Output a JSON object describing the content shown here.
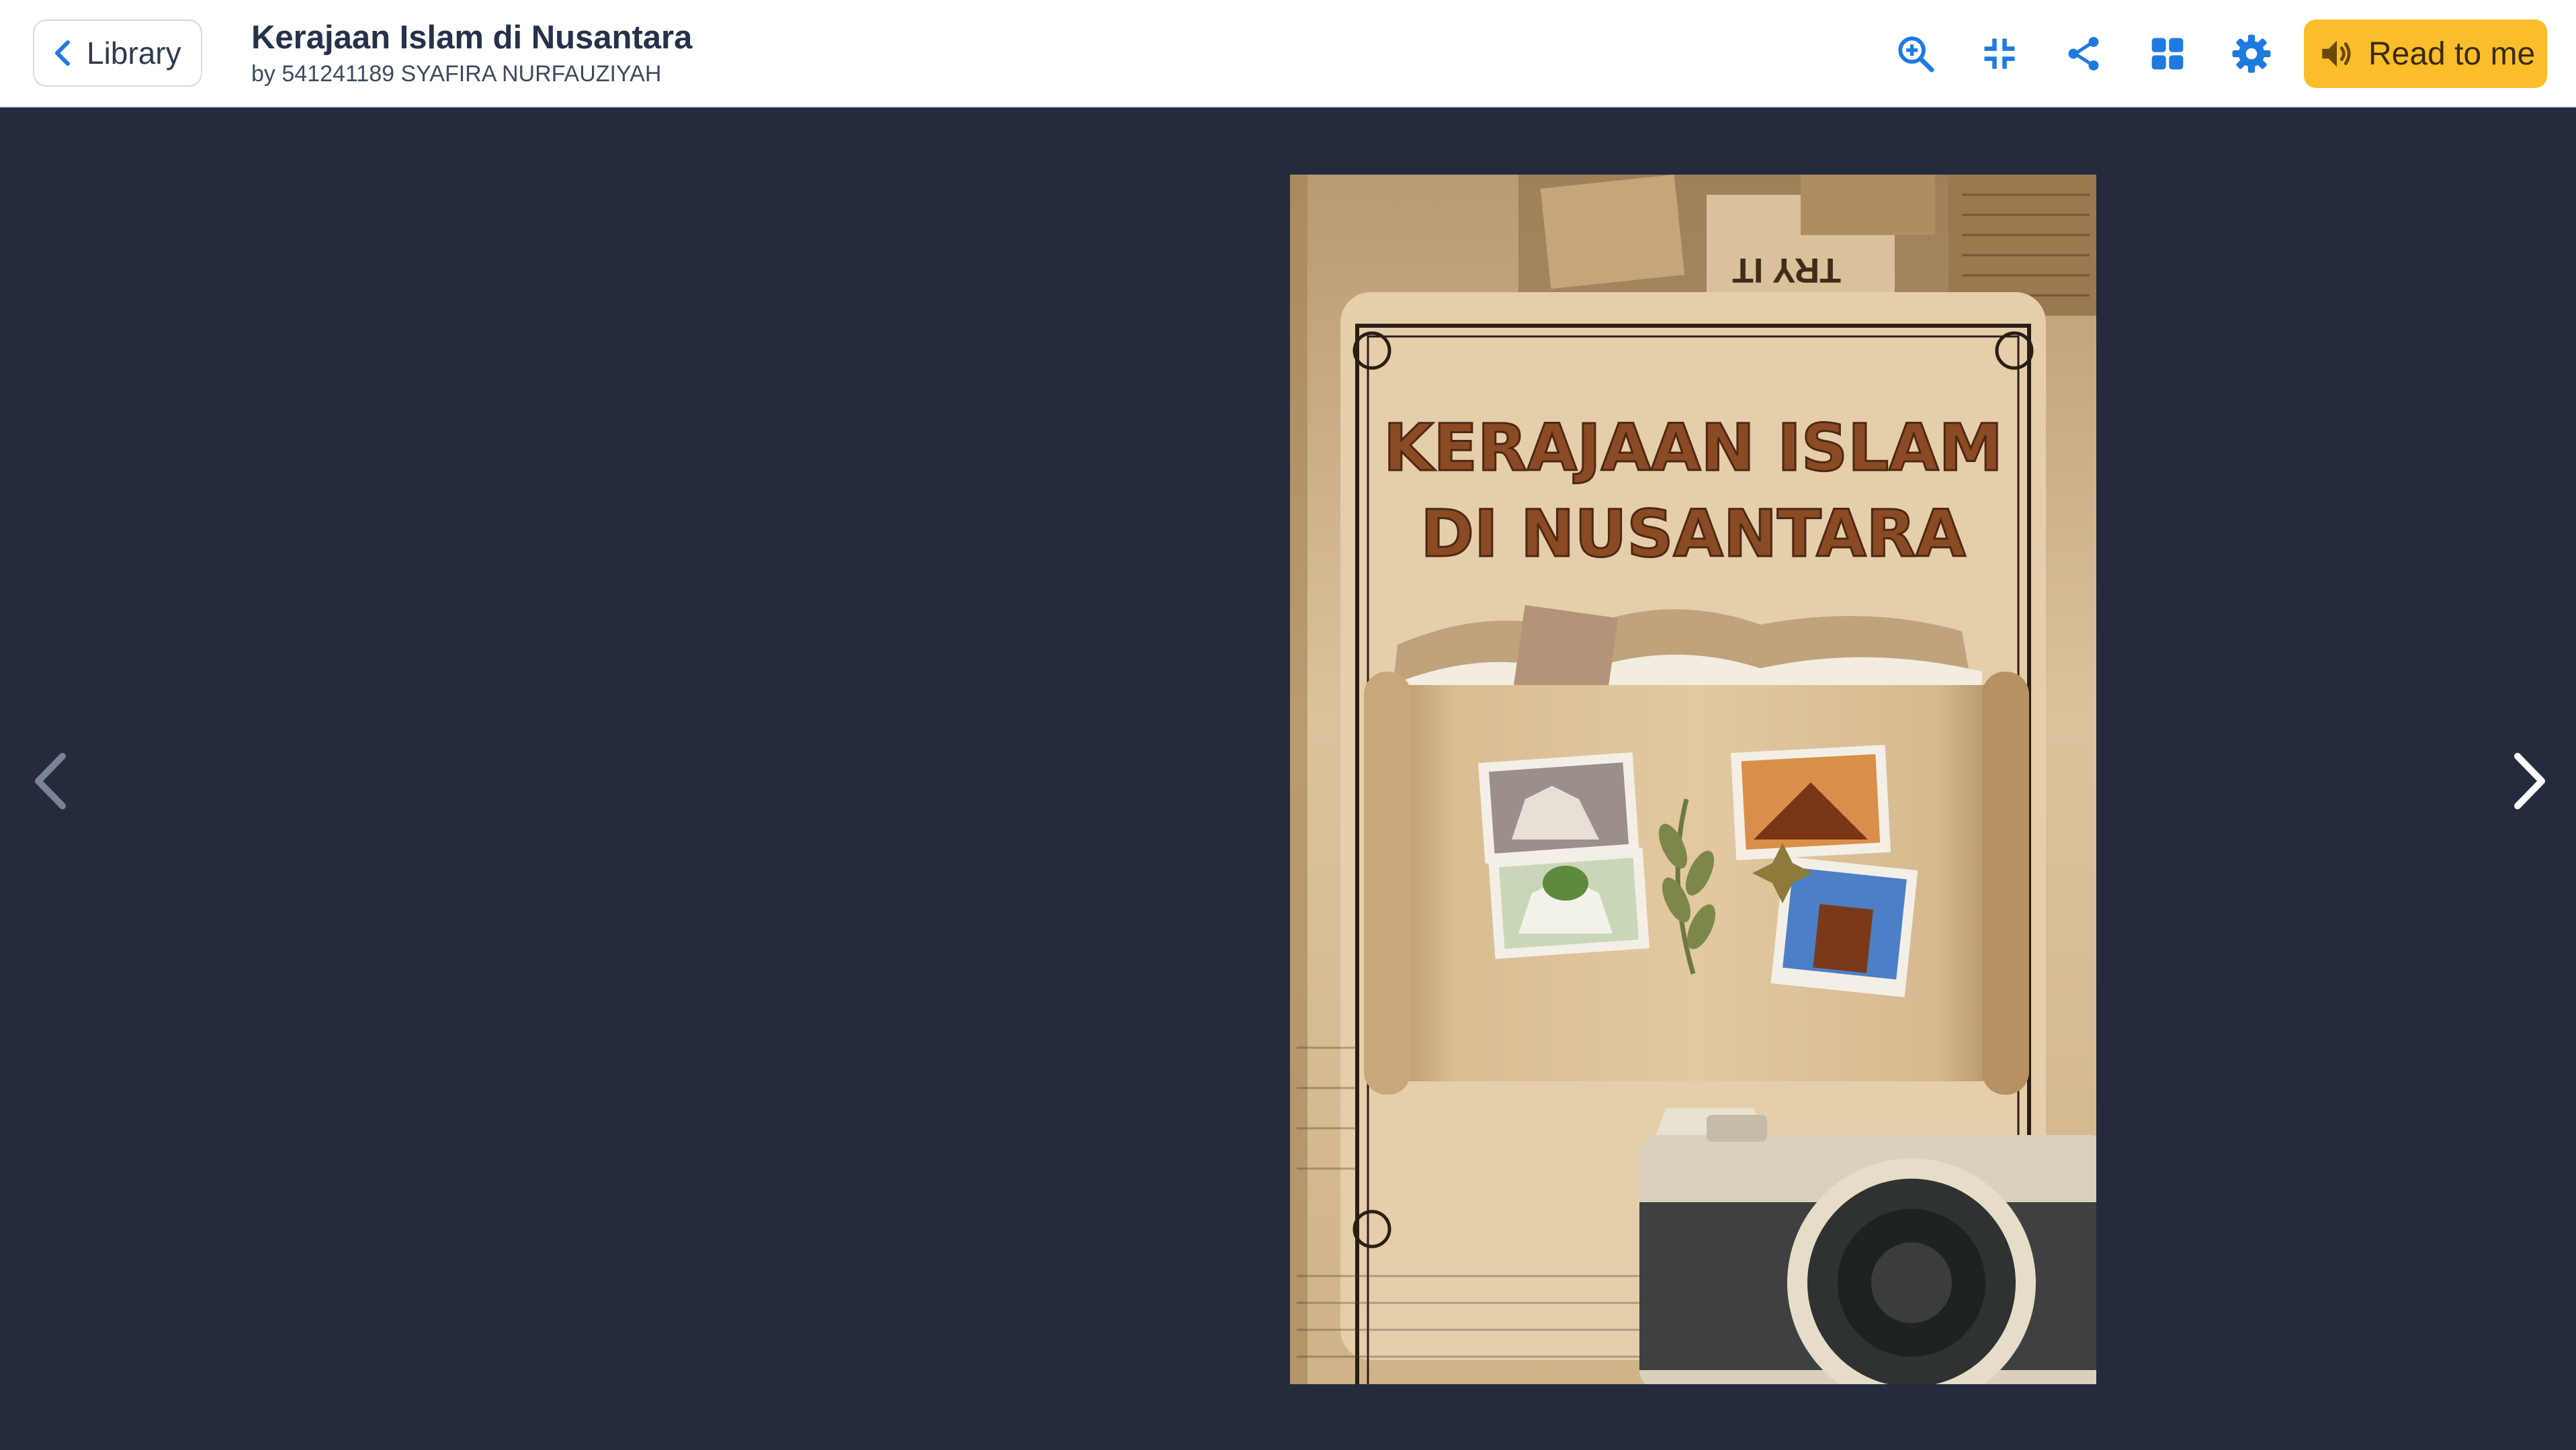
{
  "header": {
    "back_label": "Library",
    "title": "Kerajaan Islam di Nusantara",
    "author": "by 541241189 SYAFIRA NURFAUZIYAH",
    "read_label": "Read to me"
  },
  "toolbar": {
    "icons": [
      "zoom-in-icon",
      "exit-fullscreen-icon",
      "share-icon",
      "grid-view-icon",
      "settings-icon",
      "speaker-icon"
    ]
  },
  "cover": {
    "title_line1": "KERAJAAN ISLAM",
    "title_line2": "DI NUSANTARA",
    "clipping_text": "TRY IT"
  },
  "colors": {
    "accent_blue": "#1f7ae0",
    "read_button": "#f9be2a",
    "background": "#232b3d",
    "cover_title": "#8a4a24"
  }
}
